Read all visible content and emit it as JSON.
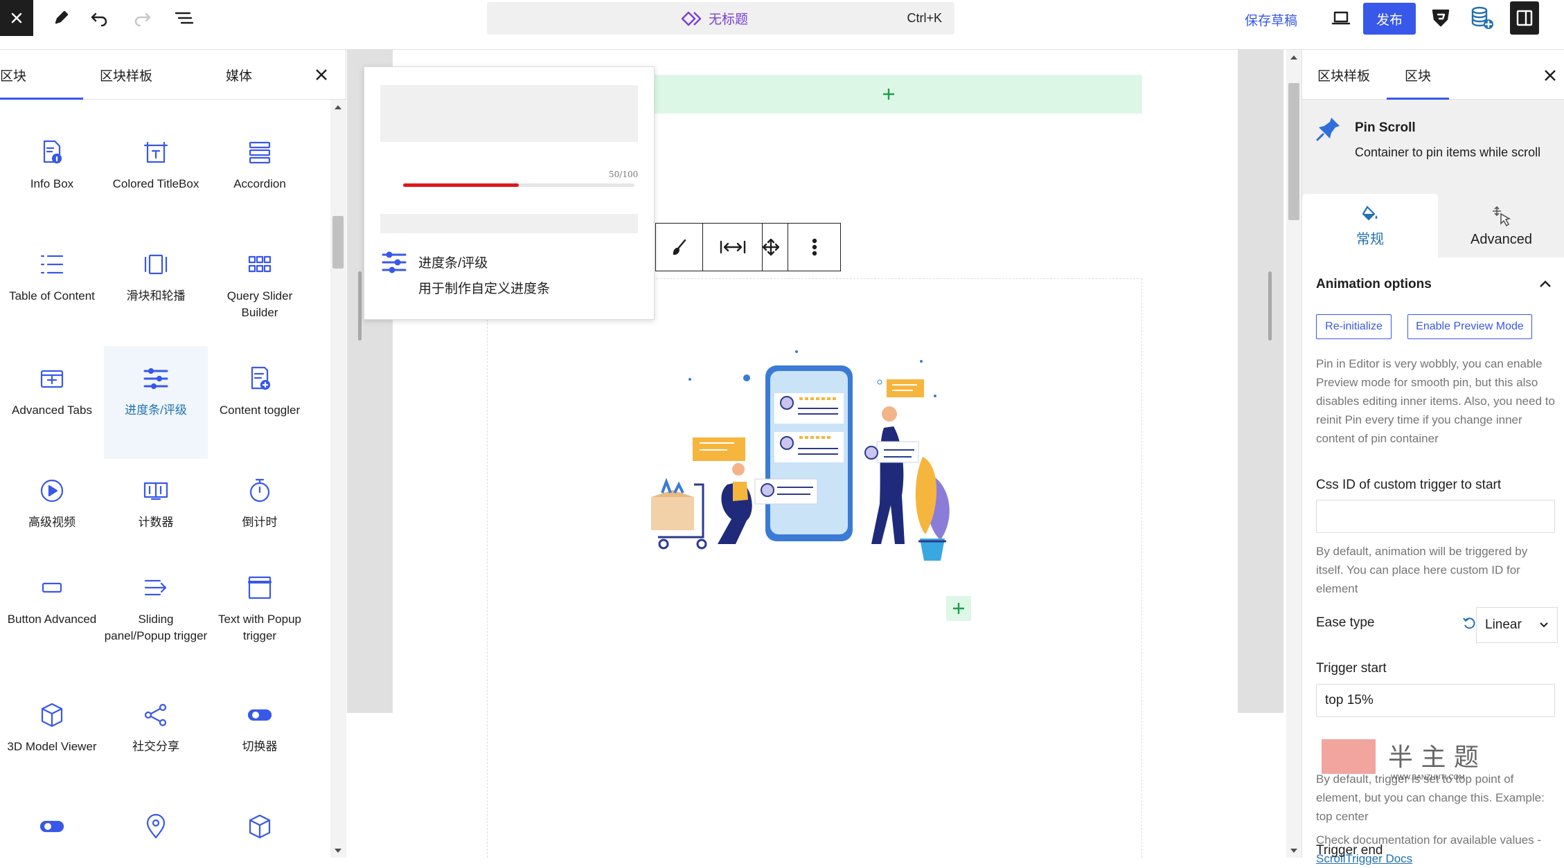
{
  "topbar": {
    "doc_title": "无标题",
    "shortcut": "Ctrl+K",
    "save_draft": "保存草稿",
    "publish": "发布"
  },
  "inserter": {
    "tabs": [
      "区块",
      "区块样板",
      "媒体"
    ],
    "blocks": [
      {
        "label": "Info Box",
        "icon": "info-box-icon"
      },
      {
        "label": "Colored TitleBox",
        "icon": "colored-titlebox-icon"
      },
      {
        "label": "Accordion",
        "icon": "accordion-icon"
      },
      {
        "label": "Table of Content",
        "icon": "table-of-content-icon"
      },
      {
        "label": "滑块和轮播",
        "icon": "slider-icon"
      },
      {
        "label": "Query Slider Builder",
        "icon": "grid-icon"
      },
      {
        "label": "Advanced Tabs",
        "icon": "tabs-icon"
      },
      {
        "label": "进度条/评级",
        "icon": "progress-icon"
      },
      {
        "label": "Content toggler",
        "icon": "content-toggler-icon"
      },
      {
        "label": "高级视频",
        "icon": "video-icon"
      },
      {
        "label": "计数器",
        "icon": "counter-icon"
      },
      {
        "label": "倒计时",
        "icon": "timer-icon"
      },
      {
        "label": "Button Advanced",
        "icon": "button-icon"
      },
      {
        "label": "Sliding panel/Popup trigger",
        "icon": "sliding-panel-icon"
      },
      {
        "label": "Text with Popup trigger",
        "icon": "popup-window-icon"
      },
      {
        "label": "3D Model Viewer",
        "icon": "cube-icon"
      },
      {
        "label": "社交分享",
        "icon": "share-icon"
      },
      {
        "label": "切换器",
        "icon": "toggle-icon"
      }
    ]
  },
  "preview": {
    "progress_label": "50/100",
    "progress_value": 0.5,
    "title": "进度条/评级",
    "description": "用于制作自定义进度条"
  },
  "settings": {
    "tabs": [
      "区块样板",
      "区块"
    ],
    "block_name": "Pin Scroll",
    "block_desc": "Container to pin items while scroll",
    "style_tabs": [
      "常规",
      "Advanced"
    ],
    "section_title": "Animation options",
    "btn_reinit": "Re-initialize",
    "btn_preview": "Enable Preview Mode",
    "help_pin": "Pin in Editor is very wobbly, you can enable Preview mode for smooth pin, but this also disables editing inner items. Also, you need to reinit Pin every time if you change inner content of pin container",
    "css_id_label": "Css ID of custom trigger to start",
    "css_id_value": "",
    "help_css": "By default, animation will be triggered by itself. You can place here custom ID for element",
    "ease_label": "Ease type",
    "ease_value": "Linear",
    "trigger_start_label": "Trigger start",
    "trigger_start_value": "top 15%",
    "help_trigger": "By default, trigger is set to top point of element, but you can change this. Example: top center",
    "help_docs": "Check documentation for available values - ",
    "docs_link": "ScrollTrigger Docs",
    "trigger_end_label": "Trigger end"
  },
  "watermark": {
    "text": "WWW.BANZHUTI.COM"
  },
  "colors": {
    "accent": "#3858e9",
    "link": "#2271b1",
    "progress": "#e0161b",
    "green": "#ddf7e6"
  }
}
